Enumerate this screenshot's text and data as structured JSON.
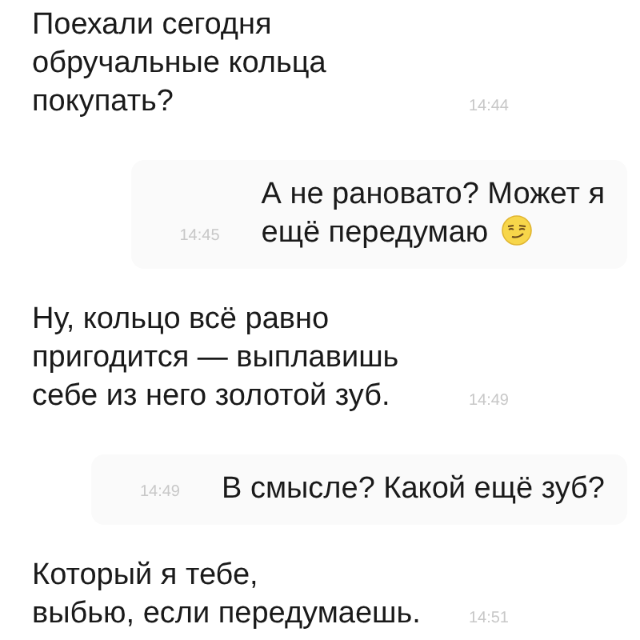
{
  "messages": [
    {
      "kind": "incoming",
      "text": "Поехали сегодня\nобручальные кольца\nпокупать?",
      "time": "14:44"
    },
    {
      "kind": "outgoing",
      "text": "А не рановато? Может я\nещё передумаю",
      "emoji": true,
      "time": "14:45"
    },
    {
      "kind": "incoming",
      "text": "Ну, кольцо всё равно\nпригодится — выплавишь\nсебе из него золотой зуб.",
      "time": "14:49"
    },
    {
      "kind": "outgoing",
      "text": "В смысле? Какой ещё зуб?",
      "emoji": false,
      "time": "14:49"
    },
    {
      "kind": "incoming",
      "text": "Который я тебе,\nвыбью, если передумаешь.",
      "time": "14:51"
    }
  ]
}
